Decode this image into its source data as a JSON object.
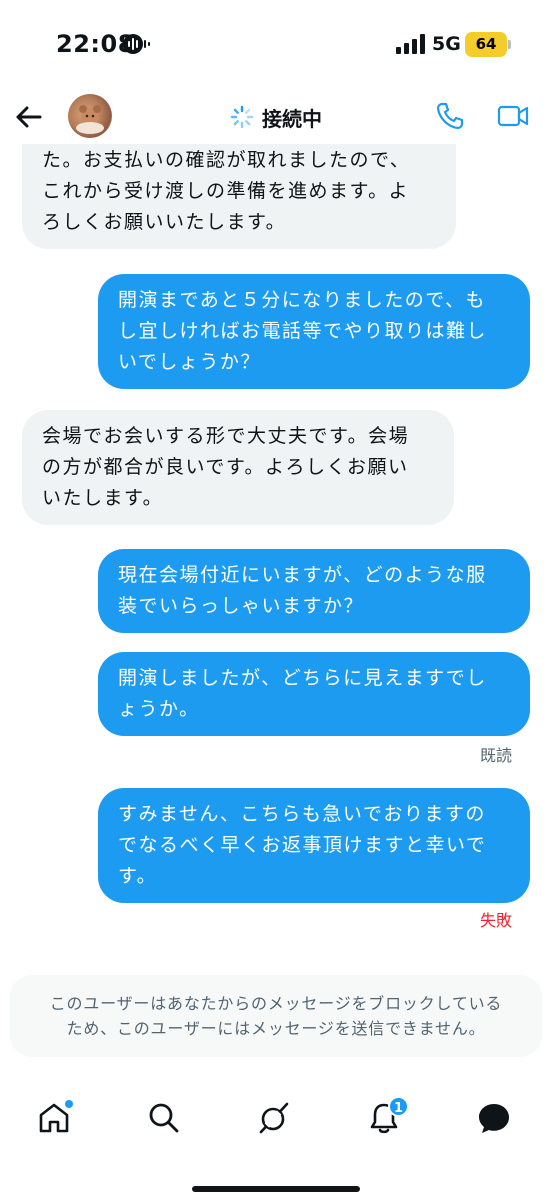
{
  "status_bar": {
    "time": "22:08",
    "network": "5G",
    "battery": "64",
    "battery_color": "#f5cd2b"
  },
  "header": {
    "title": "接続中",
    "icons": [
      "back-arrow-icon",
      "avatar",
      "loading-spinner-icon",
      "phone-icon",
      "video-camera-icon"
    ]
  },
  "messages": [
    {
      "side": "received",
      "lines": [
        "た。お支払いの確認が取れましたので、",
        "これから受け渡しの準備を進めます。よ",
        "ろしくお願いいたします。"
      ]
    },
    {
      "side": "sent",
      "lines": [
        "開演まであと５分になりましたので、も",
        "し宜しければお電話等でやり取りは難し",
        "いでしょうか？"
      ]
    },
    {
      "side": "received",
      "lines": [
        "会場でお会いする形で大丈夫です。会場",
        "の方が都合が良いです。よろしくお願い",
        "いたします。"
      ]
    },
    {
      "side": "sent",
      "lines": [
        "現在会場付近にいますが、どのような服",
        "装でいらっしゃいますか？"
      ]
    },
    {
      "side": "sent",
      "lines": [
        "開演しましたが、どちらに見えますでし",
        "ょうか。"
      ],
      "status": "既読"
    },
    {
      "side": "sent",
      "lines": [
        "すみません、こちらも急いでおりますの",
        "でなるべく早くお返事頂けますと幸いで",
        "す。"
      ],
      "status": "失敗"
    }
  ],
  "blocked_notice": {
    "line1": "このユーザーはあなたからのメッセージをブロックしている",
    "line2": "ため、このユーザーにはメッセージを送信できません。"
  },
  "bottom_nav": {
    "items": [
      "home-icon",
      "search-icon",
      "grok-icon",
      "notifications-icon",
      "messages-icon"
    ],
    "notifications_badge": "1"
  },
  "colors": {
    "accent": "#1d9bf0",
    "received_bubble": "#eff3f4",
    "error": "#f4212e",
    "muted_text": "#536471"
  }
}
